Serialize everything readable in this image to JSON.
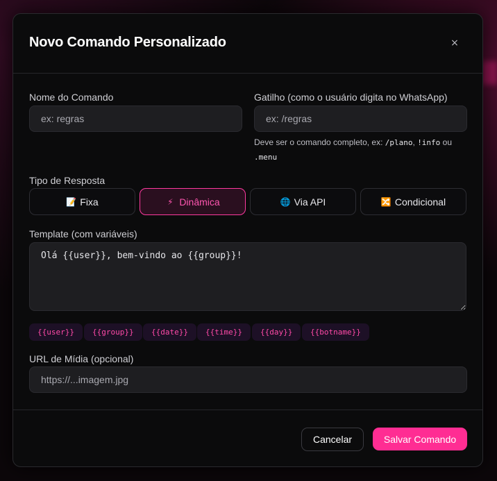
{
  "modal": {
    "title": "Novo Comando Personalizado",
    "close_label": "×"
  },
  "fields": {
    "name": {
      "label": "Nome do Comando",
      "placeholder": "ex: regras",
      "value": ""
    },
    "trigger": {
      "label": "Gatilho (como o usuário digita no WhatsApp)",
      "placeholder": "ex: /regras",
      "value": "",
      "hint_prefix": "Deve ser o comando completo, ex: ",
      "hint_ex1": "/plano",
      "hint_sep1": ", ",
      "hint_ex2": "!info",
      "hint_sep2": " ou ",
      "hint_ex3": ".menu"
    },
    "response_type": {
      "label": "Tipo de Resposta",
      "selected": "Dinâmica",
      "options": [
        {
          "label": "Fixa",
          "icon": "memo-icon",
          "glyph": "📝"
        },
        {
          "label": "Dinâmica",
          "icon": "lightning-icon",
          "glyph": "⚡"
        },
        {
          "label": "Via API",
          "icon": "globe-icon",
          "glyph": "🌐"
        },
        {
          "label": "Condicional",
          "icon": "shuffle-icon",
          "glyph": "🔀"
        }
      ]
    },
    "template": {
      "label": "Template (com variáveis)",
      "value": "Olá {{user}}, bem-vindo ao {{group}}!"
    },
    "variables": [
      "{{user}}",
      "{{group}}",
      "{{date}}",
      "{{time}}",
      "{{day}}",
      "{{botname}}"
    ],
    "media_url": {
      "label": "URL de Mídia (opcional)",
      "placeholder": "https://...imagem.jpg",
      "value": ""
    }
  },
  "footer": {
    "cancel_label": "Cancelar",
    "save_label": "Salvar Comando"
  },
  "colors": {
    "accent": "#ff2d93",
    "accent_text": "#ff56b0",
    "modal_bg": "#0b0b0c",
    "input_bg": "#1e1e21"
  }
}
